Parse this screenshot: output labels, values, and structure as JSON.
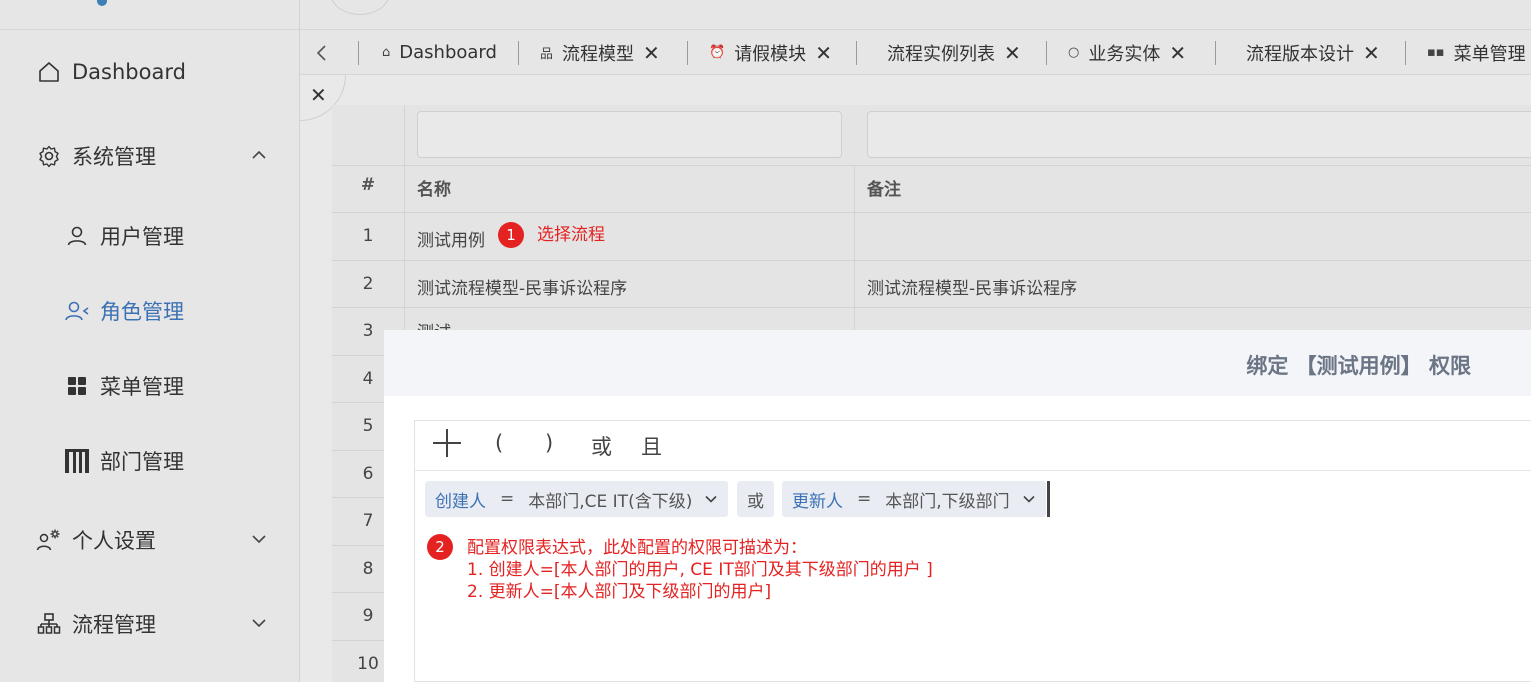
{
  "sidebar": {
    "items": [
      {
        "label": "Dashboard",
        "icon": "home-icon"
      },
      {
        "label": "系统管理",
        "icon": "gear-icon",
        "expanded": true
      },
      {
        "label": "用户管理",
        "icon": "user-icon"
      },
      {
        "label": "角色管理",
        "icon": "role-icon",
        "active": true
      },
      {
        "label": "菜单管理",
        "icon": "grid-icon"
      },
      {
        "label": "部门管理",
        "icon": "building-icon"
      },
      {
        "label": "个人设置",
        "icon": "user-settings-icon",
        "expanded": false
      },
      {
        "label": "流程管理",
        "icon": "flow-icon",
        "expanded": false
      }
    ]
  },
  "tabs": [
    {
      "label": "Dashboard",
      "icon": "⌂",
      "closable": false
    },
    {
      "label": "流程模型",
      "icon": "品",
      "closable": true
    },
    {
      "label": "请假模块",
      "icon": "⏰",
      "closable": true
    },
    {
      "label": "流程实例列表",
      "icon": "",
      "closable": true
    },
    {
      "label": "业务实体",
      "icon": "○",
      "closable": true
    },
    {
      "label": "流程版本设计",
      "icon": "",
      "closable": true
    },
    {
      "label": "菜单管理",
      "icon": "▪▪",
      "closable": false
    }
  ],
  "table": {
    "headers": [
      "#",
      "名称",
      "备注"
    ],
    "rows": [
      {
        "index": "1",
        "name": "测试用例",
        "remark": ""
      },
      {
        "index": "2",
        "name": "测试流程模型-民事诉讼程序",
        "remark": "测试流程模型-民事诉讼程序"
      },
      {
        "index": "3",
        "name": "测试",
        "remark": ""
      },
      {
        "index": "4",
        "name": "",
        "remark": ""
      },
      {
        "index": "5",
        "name": "",
        "remark": ""
      },
      {
        "index": "6",
        "name": "",
        "remark": ""
      },
      {
        "index": "7",
        "name": "",
        "remark": ""
      },
      {
        "index": "8",
        "name": "",
        "remark": ""
      },
      {
        "index": "9",
        "name": "",
        "remark": ""
      },
      {
        "index": "10",
        "name": "",
        "remark": ""
      }
    ]
  },
  "annotations": {
    "badge1": "1",
    "note1": "选择流程",
    "badge2": "2",
    "note2_line1": "配置权限表达式，此处配置的权限可描述为：",
    "note2_line2": "1. 创建人=[本人部门的用户, CE IT部门及其下级部门的用户 ]",
    "note2_line3": "2. 更新人=[本人部门及下级部门的用户]",
    "color": "#e52222"
  },
  "modal": {
    "title": "绑定 【测试用例】 权限",
    "toolbar": {
      "add": "+",
      "lparen": "(",
      "rparen": ")",
      "or": "或",
      "and": "且"
    },
    "conditions": [
      {
        "field": "创建人",
        "op": "=",
        "value": "本部门,CE IT(含下级)"
      },
      {
        "connector": "或"
      },
      {
        "field": "更新人",
        "op": "=",
        "value": "本部门,下级部门"
      }
    ]
  },
  "colors": {
    "accent": "#3c72b5",
    "annotation": "#e52222",
    "sidebar_bg": "#e6e6e6"
  }
}
